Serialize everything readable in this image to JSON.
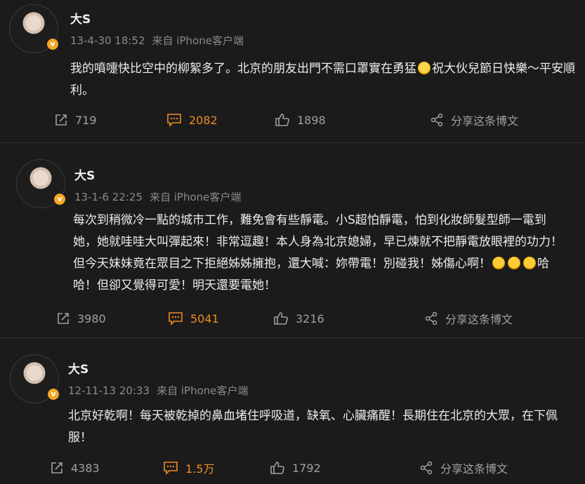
{
  "posts": [
    {
      "author": "大S",
      "time": "13-4-30 18:52",
      "source": "来自 iPhone客户端",
      "text_parts": [
        "我的噴嚏快比空中的柳絮多了。北京的朋友出門不需口罩實在勇猛",
        "祝大伙兒節日快樂～平安順利。"
      ],
      "emojis": [
        "cry-emoji"
      ],
      "reposts": "719",
      "comments": "2082",
      "likes": "1898",
      "share_label": "分享这条博文"
    },
    {
      "author": "大S",
      "time": "13-1-6 22:25",
      "source": "来自 iPhone客户端",
      "text_parts": [
        "每次到稍微冷一點的城市工作，難免會有些靜電。小S超怕靜電，怕到化妝師髮型師一電到她，她就哇哇大叫彈起來！非常逗趣！本人身為北京媳婦，早已煉就不把靜電放眼裡的功力！但今天妹妹竟在眾目之下拒絕姊姊擁抱，還大喊：妳帶電！別碰我！姊傷心啊！",
        "哈哈！但卻又覺得可愛！明天還要電她！"
      ],
      "emojis": [
        "angry-emoji",
        "angry-emoji",
        "angry-emoji"
      ],
      "reposts": "3980",
      "comments": "5041",
      "likes": "3216",
      "share_label": "分享这条博文"
    },
    {
      "author": "大S",
      "time": "12-11-13 20:33",
      "source": "来自 iPhone客户端",
      "text_parts": [
        "北京好乾啊！每天被乾掉的鼻血堵住呼吸道，缺氧、心臟痛醒！長期住在北京的大眾，在下佩服！"
      ],
      "emojis": [],
      "reposts": "4383",
      "comments": "1.5万",
      "likes": "1792",
      "share_label": "分享这条博文"
    }
  ],
  "colors": {
    "background": "#1b1b1b",
    "comment_accent": "#f08a24",
    "vip_badge": "#f5a623"
  }
}
